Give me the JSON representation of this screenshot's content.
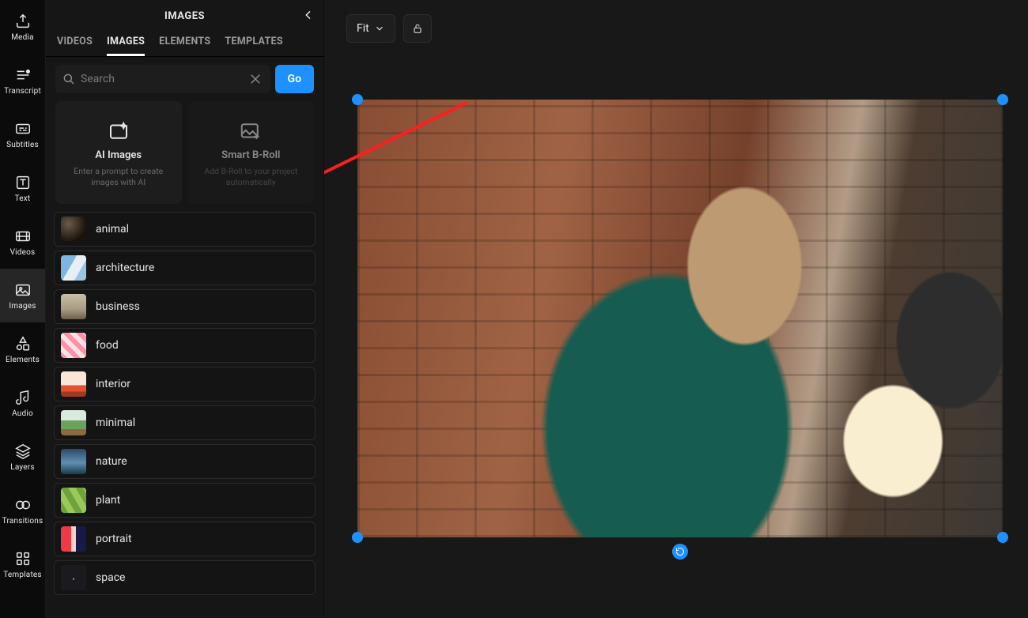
{
  "rail": {
    "items": [
      {
        "key": "media",
        "label": "Media",
        "icon": "upload"
      },
      {
        "key": "transcript",
        "label": "Transcript",
        "icon": "transcript"
      },
      {
        "key": "subtitles",
        "label": "Subtitles",
        "icon": "subtitles"
      },
      {
        "key": "text",
        "label": "Text",
        "icon": "text"
      },
      {
        "key": "videos",
        "label": "Videos",
        "icon": "video"
      },
      {
        "key": "images",
        "label": "Images",
        "icon": "image",
        "active": true
      },
      {
        "key": "elements",
        "label": "Elements",
        "icon": "shapes"
      },
      {
        "key": "audio",
        "label": "Audio",
        "icon": "audio"
      },
      {
        "key": "layers",
        "label": "Layers",
        "icon": "layers"
      },
      {
        "key": "transitions",
        "label": "Transitions",
        "icon": "transition"
      },
      {
        "key": "templates",
        "label": "Templates",
        "icon": "templates"
      }
    ]
  },
  "panel": {
    "title": "IMAGES",
    "tabs": [
      {
        "key": "videos",
        "label": "VIDEOS"
      },
      {
        "key": "images",
        "label": "IMAGES",
        "active": true
      },
      {
        "key": "elements",
        "label": "ELEMENTS"
      },
      {
        "key": "templates",
        "label": "TEMPLATES"
      }
    ],
    "search_placeholder": "Search",
    "search_value": "",
    "go_label": "Go",
    "cards": [
      {
        "key": "ai",
        "title": "AI Images",
        "sub": "Enter a prompt to create images with AI",
        "icon": "sparkle-image"
      },
      {
        "key": "broll",
        "title": "Smart B-Roll",
        "sub": "Add B-Roll to your project automatically",
        "icon": "image-plus",
        "dim": true
      }
    ],
    "categories": [
      {
        "key": "animal",
        "label": "animal"
      },
      {
        "key": "architecture",
        "label": "architecture"
      },
      {
        "key": "business",
        "label": "business"
      },
      {
        "key": "food",
        "label": "food"
      },
      {
        "key": "interior",
        "label": "interior"
      },
      {
        "key": "minimal",
        "label": "minimal"
      },
      {
        "key": "nature",
        "label": "nature"
      },
      {
        "key": "plant",
        "label": "plant"
      },
      {
        "key": "portrait",
        "label": "portrait"
      },
      {
        "key": "space",
        "label": "space"
      }
    ]
  },
  "stage": {
    "fit_label": "Fit",
    "accent": "#1e90ff"
  }
}
